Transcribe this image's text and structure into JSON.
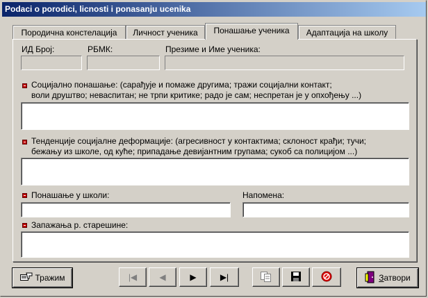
{
  "window": {
    "title": "Podaci o porodici, licnosti i ponasanju ucenika"
  },
  "tabs": [
    {
      "label": "Породична констелација"
    },
    {
      "label": "Личност ученика"
    },
    {
      "label": "Понашање ученика"
    },
    {
      "label": "Адаптација на школу"
    }
  ],
  "header_fields": {
    "id_label": "ИД Број:",
    "id_value": "",
    "rbmk_label": "РБМК:",
    "rbmk_value": "",
    "name_label": "Презиме и Име ученика:",
    "name_value": ""
  },
  "social_behavior": {
    "label_line1": "Социјално понашање: (сарађује и помаже другима;  тражи социјални контакт;",
    "label_line2": "воли друштво; неваспитан; не трпи критике;  радо је сам; неспретан је у опхођењу ...)",
    "value": ""
  },
  "social_deformation": {
    "label_line1": "Тенденције социјалне деформације: (агресивност у контактима; склоност крађи; тучи;",
    "label_line2": "бежању из школе, од куће; припадање девијантним групама; сукоб са полицијом ...)",
    "value": ""
  },
  "school_behavior": {
    "label": "Понашање у школи:",
    "value": ""
  },
  "note": {
    "label": "Напомена:",
    "value": ""
  },
  "teacher_observations": {
    "label": "Запажања р. старешине:",
    "value": ""
  },
  "toolbar": {
    "search_label": "Тражим",
    "first": "|◀",
    "prev": "◀",
    "next": "▶",
    "last": "▶|",
    "close_label": "Затвори"
  }
}
